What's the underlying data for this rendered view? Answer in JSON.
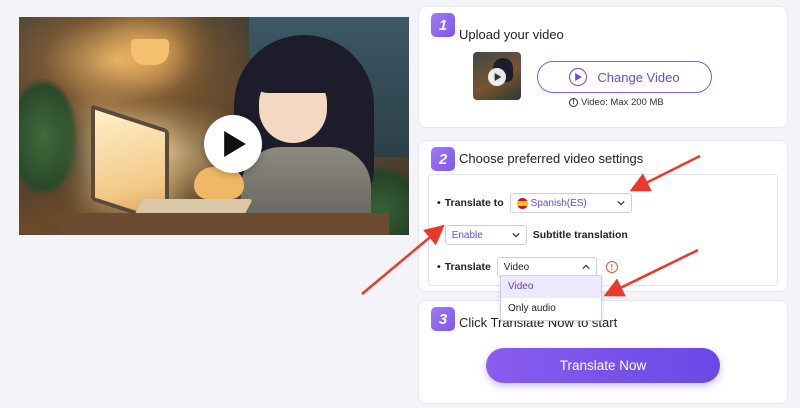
{
  "steps": [
    {
      "number": "1",
      "title": "Upload your video"
    },
    {
      "number": "2",
      "title": "Choose preferred video settings"
    },
    {
      "number": "3",
      "title": "Click Translate Now to start"
    }
  ],
  "upload": {
    "change_label": "Change Video",
    "limit_text": "Video: Max 200 MB"
  },
  "settings": {
    "translate_to_label": "Translate to",
    "language_value": "Spanish(ES)",
    "subtitle_value": "Enable",
    "subtitle_label": "Subtitle translation",
    "translate_label": "Translate",
    "translate_value": "Video",
    "options": [
      "Video",
      "Only audio"
    ]
  },
  "action": {
    "translate_now": "Translate Now"
  },
  "colors": {
    "accent": "#6a48dd",
    "button": "#7d55ea",
    "arrow": "#e8392c",
    "background": "#f4f3f8"
  }
}
